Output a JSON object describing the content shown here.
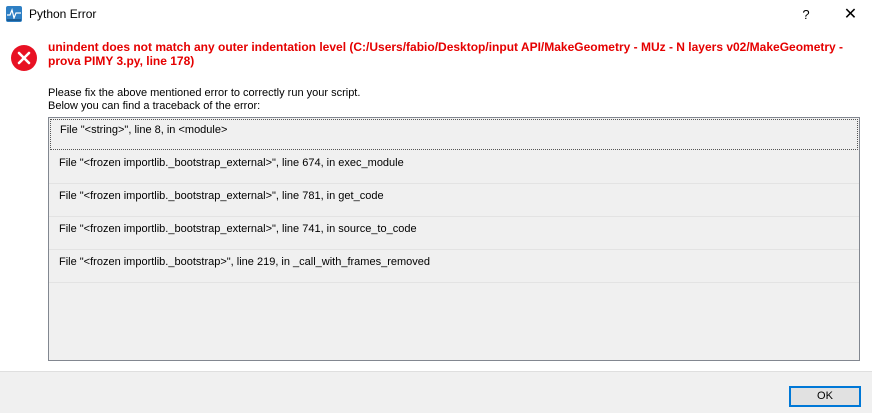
{
  "window": {
    "title": "Python Error",
    "help_label": "?",
    "close_label": "✕",
    "icon": "stko-app-icon"
  },
  "error": {
    "icon": "error-icon",
    "message": "unindent does not match any outer indentation level (C:/Users/fabio/Desktop/input API/MakeGeometry - MUz - N layers v02/MakeGeometry - prova PIMY 3.py, line 178)"
  },
  "info": {
    "line1": "Please fix the above mentioned error to correctly run your script.",
    "line2": "Below you can find a traceback of the error:"
  },
  "traceback": [
    "File \"<string>\", line 8, in <module>",
    "File \"<frozen importlib._bootstrap_external>\", line 674, in exec_module",
    "File \"<frozen importlib._bootstrap_external>\", line 781, in get_code",
    "File \"<frozen importlib._bootstrap_external>\", line 741, in source_to_code",
    "File \"<frozen importlib._bootstrap>\", line 219, in _call_with_frames_removed"
  ],
  "footer": {
    "ok_label": "OK"
  },
  "colors": {
    "error_red": "#e50000",
    "accent": "#0078d7"
  }
}
